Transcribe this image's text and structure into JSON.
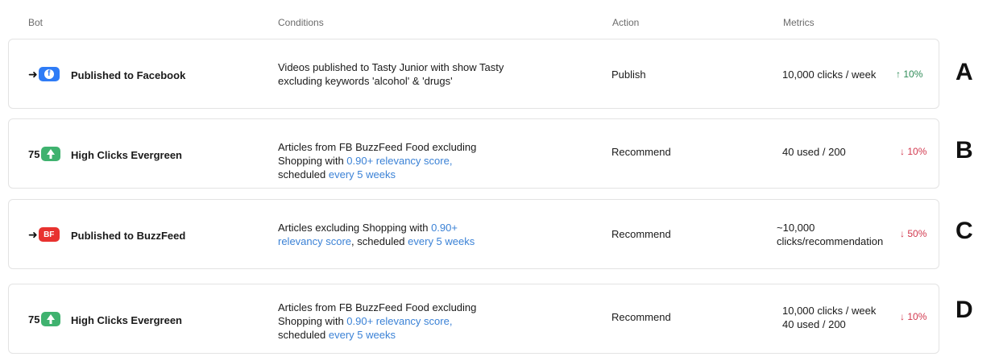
{
  "headers": {
    "bot": "Bot",
    "conditions": "Conditions",
    "action": "Action",
    "metrics": "Metrics"
  },
  "rows": [
    {
      "letter": "A",
      "bot_icon": "facebook-icon",
      "bot_name": "Published to Facebook",
      "conditions": {
        "line1": "Videos published to Tasty Junior with show Tasty",
        "line2": "excluding keywords 'alcohol' & 'drugs'"
      },
      "action": "Publish",
      "metrics": {
        "line1": "10,000 clicks / week",
        "line2": ""
      },
      "trend": {
        "direction": "up",
        "arrow": "↑",
        "value": "10%"
      }
    },
    {
      "letter": "B",
      "bot_icon": "evergreen-tree-icon",
      "bot_number": "75",
      "bot_name": "High Clicks Evergreen",
      "conditions": {
        "p1": "Articles from FB BuzzFeed Food  excluding",
        "p2": "Shopping with ",
        "p2_link": "0.90+ relevancy score,",
        "p3": "scheduled ",
        "p3_link": "every 5 weeks"
      },
      "action": "Recommend",
      "metrics": {
        "line1": "40 used / 200",
        "line2": ""
      },
      "trend": {
        "direction": "down",
        "arrow": "↓",
        "value": "10%"
      }
    },
    {
      "letter": "C",
      "bot_icon": "buzzfeed-icon",
      "bot_badge": "BF",
      "bot_name": "Published to BuzzFeed",
      "conditions": {
        "p1": "Articles excluding Shopping with ",
        "p1_link": "0.90+",
        "p2_link": "relevancy score",
        "p2": ", scheduled ",
        "p2_link2": "every 5 weeks"
      },
      "action": "Recommend",
      "metrics": {
        "line1": "~10,000",
        "line2": "clicks/recommendation"
      },
      "trend": {
        "direction": "down",
        "arrow": "↓",
        "value": "50%"
      }
    },
    {
      "letter": "D",
      "bot_icon": "evergreen-tree-icon",
      "bot_number": "75",
      "bot_name": "High Clicks Evergreen",
      "conditions": {
        "p1": "Articles from FB BuzzFeed Food  excluding",
        "p2": "Shopping with ",
        "p2_link": "0.90+ relevancy score,",
        "p3": "scheduled ",
        "p3_link": "every 5 weeks"
      },
      "action": "Recommend",
      "metrics": {
        "line1": "10,000 clicks / week",
        "line2": "40 used / 200"
      },
      "trend": {
        "direction": "down",
        "arrow": "↓",
        "value": "10%"
      }
    }
  ],
  "colors": {
    "link": "#3b82d6",
    "up": "#2e8b57",
    "down": "#d2384e",
    "facebook": "#2f7cf6",
    "buzzfeed": "#e8322f",
    "evergreen": "#3fb26f"
  }
}
